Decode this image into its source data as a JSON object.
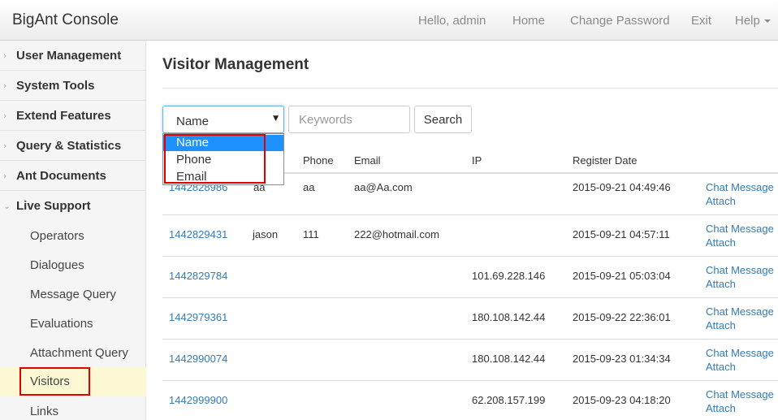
{
  "header": {
    "brand": "BigAnt Console",
    "greeting": "Hello, admin",
    "home": "Home",
    "change_password": "Change Password",
    "exit": "Exit",
    "help": "Help"
  },
  "sidebar": {
    "menus": [
      "User Management",
      "System Tools",
      "Extend Features",
      "Query & Statistics",
      "Ant Documents",
      "Live Support"
    ],
    "live_support_items": [
      "Operators",
      "Dialogues",
      "Message Query",
      "Evaluations",
      "Attachment Query",
      "Visitors",
      "Links"
    ],
    "active_item": "Visitors"
  },
  "main": {
    "title": "Visitor Management",
    "search": {
      "field_value": "Name",
      "options": [
        "Name",
        "Phone",
        "Email"
      ],
      "keyword_placeholder": "Keywords",
      "button_label": "Search"
    },
    "table": {
      "columns": [
        "Phone",
        "Email",
        "IP",
        "Register Date"
      ],
      "rows": [
        {
          "id": "1442828986",
          "name": "aa",
          "phone": "aa",
          "email": "aa@Aa.com",
          "ip": "",
          "date": "2015-09-21 04:49:46"
        },
        {
          "id": "1442829431",
          "name": "jason",
          "phone": "111",
          "email": "222@hotmail.com",
          "ip": "",
          "date": "2015-09-21 04:57:11"
        },
        {
          "id": "1442829784",
          "name": "",
          "phone": "",
          "email": "",
          "ip": "101.69.228.146",
          "date": "2015-09-21 05:03:04"
        },
        {
          "id": "1442979361",
          "name": "",
          "phone": "",
          "email": "",
          "ip": "180.108.142.44",
          "date": "2015-09-22 22:36:01"
        },
        {
          "id": "1442990074",
          "name": "",
          "phone": "",
          "email": "",
          "ip": "180.108.142.44",
          "date": "2015-09-23 01:34:34"
        },
        {
          "id": "1442999900",
          "name": "",
          "phone": "",
          "email": "",
          "ip": "62.208.157.199",
          "date": "2015-09-23 04:18:20"
        }
      ],
      "action_chat": "Chat Message",
      "action_attach": "Attach"
    }
  },
  "colors": {
    "link": "#337ab7",
    "highlight_box": "#e00000",
    "active_item_bg": "#fcf8d4",
    "dropdown_selected": "#1e90ff"
  }
}
